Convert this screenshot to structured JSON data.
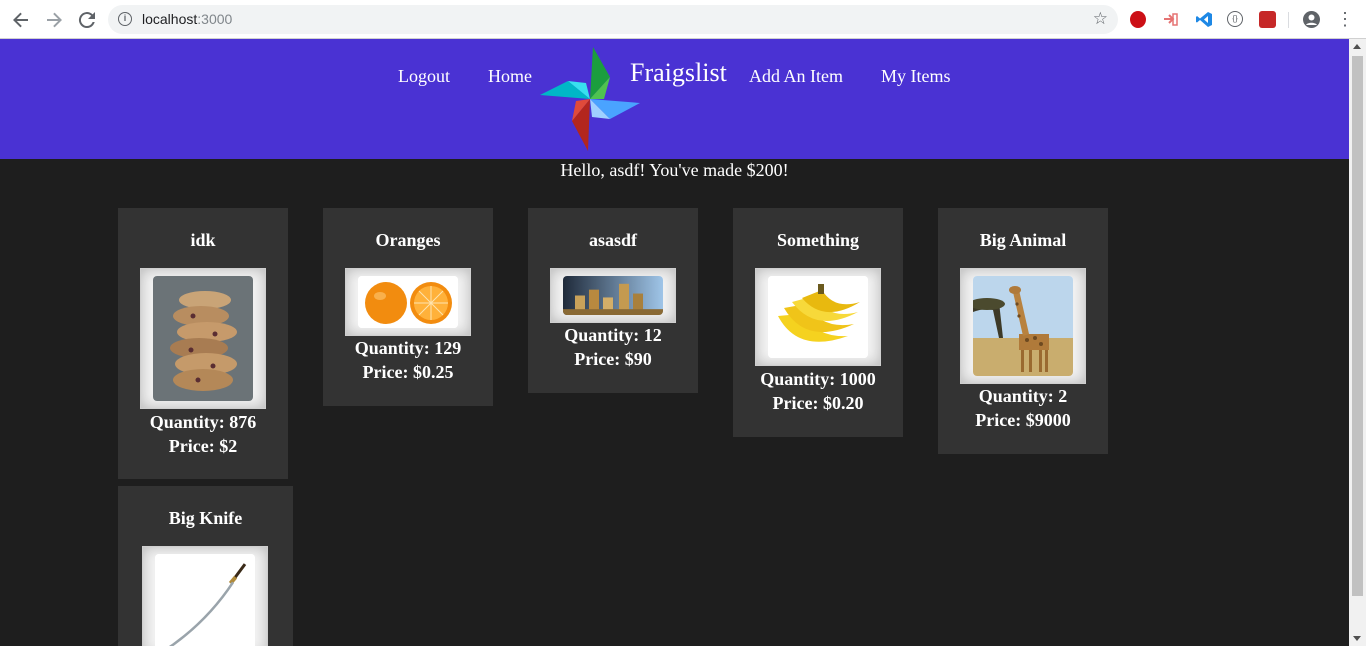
{
  "browser": {
    "url_host": "localhost",
    "url_port": ":3000",
    "back_icon": "arrow-left-icon",
    "forward_icon": "arrow-right-icon",
    "reload_icon": "reload-icon",
    "bookmark_icon": "star-icon",
    "menu_icon": "more-vert-icon"
  },
  "header": {
    "logout": "Logout",
    "home": "Home",
    "brand": "Fraigslist",
    "add_item": "Add An Item",
    "my_items": "My Items",
    "logo_icon": "pinwheel-logo",
    "bg_color": "#4a32d3"
  },
  "greeting": "Hello, asdf! You've made $200!",
  "items": [
    {
      "title": "idk",
      "quantity": "Quantity: 876",
      "price": "Price: $2",
      "image": "cookies"
    },
    {
      "title": "Oranges",
      "quantity": "Quantity: 129",
      "price": "Price: $0.25",
      "image": "oranges"
    },
    {
      "title": "asasdf",
      "quantity": "Quantity: 12",
      "price": "Price: $90",
      "image": "coins"
    },
    {
      "title": "Something",
      "quantity": "Quantity: 1000",
      "price": "Price: $0.20",
      "image": "bananas"
    },
    {
      "title": "Big Animal",
      "quantity": "Quantity: 2",
      "price": "Price: $9000",
      "image": "giraffe"
    },
    {
      "title": "Big Knife",
      "image": "katana"
    }
  ]
}
